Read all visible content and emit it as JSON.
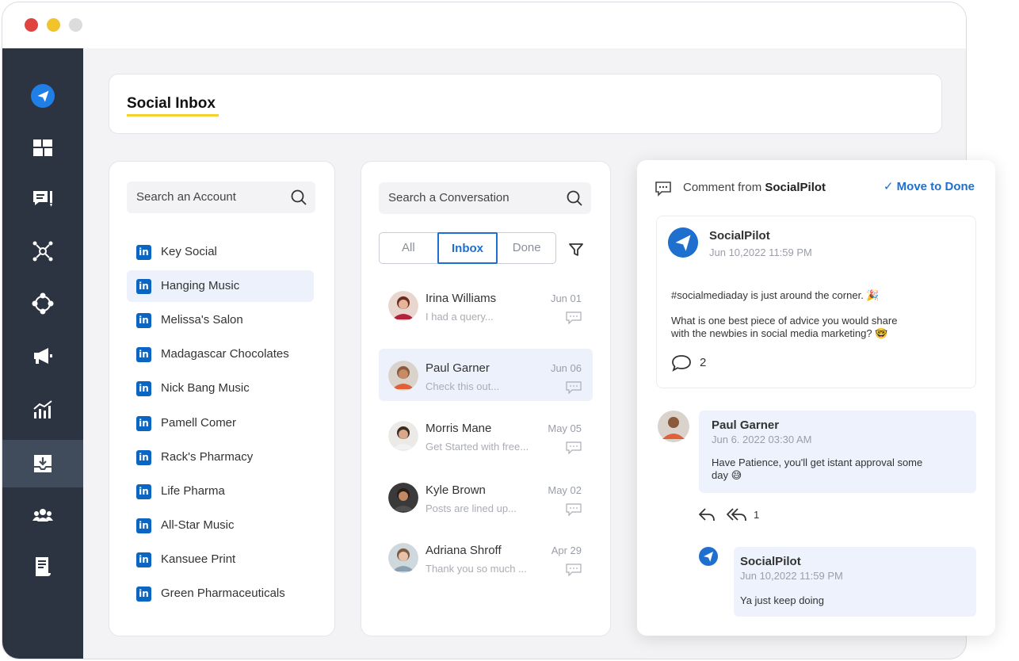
{
  "window": {
    "traffic_lights": [
      "close",
      "minimize",
      "maximize"
    ]
  },
  "sidebar": {
    "items": [
      {
        "icon": "socialpilot-logo-icon"
      },
      {
        "icon": "dashboard-icon"
      },
      {
        "icon": "posts-icon"
      },
      {
        "icon": "network-icon"
      },
      {
        "icon": "integrations-icon"
      },
      {
        "icon": "megaphone-icon"
      },
      {
        "icon": "analytics-icon"
      },
      {
        "icon": "inbox-icon",
        "active": true
      },
      {
        "icon": "team-icon"
      },
      {
        "icon": "reports-icon"
      }
    ]
  },
  "header": {
    "title": "Social Inbox"
  },
  "accounts": {
    "search_placeholder": "Search an Account",
    "items": [
      {
        "name": "Key Social"
      },
      {
        "name": "Hanging Music",
        "active": true
      },
      {
        "name": "Melissa's Salon"
      },
      {
        "name": "Madagascar Chocolates"
      },
      {
        "name": "Nick Bang Music"
      },
      {
        "name": "Pamell Comer"
      },
      {
        "name": "Rack's Pharmacy"
      },
      {
        "name": "Life Pharma"
      },
      {
        "name": "All-Star Music"
      },
      {
        "name": "Kansuee Print"
      },
      {
        "name": "Green Pharmaceuticals"
      }
    ],
    "network_icon_text": "in"
  },
  "conversations": {
    "search_placeholder": "Search a Conversation",
    "tabs": [
      "All",
      "Inbox",
      "Done"
    ],
    "active_tab": "Inbox",
    "items": [
      {
        "name": "Irina Williams",
        "preview": "I had a query...",
        "date": "Jun 01"
      },
      {
        "name": "Paul Garner",
        "preview": "Check this out...",
        "date": "Jun 06",
        "active": true
      },
      {
        "name": "Morris Mane",
        "preview": "Get Started with free...",
        "date": "May 05"
      },
      {
        "name": "Kyle Brown",
        "preview": "Posts are lined up...",
        "date": "May 02"
      },
      {
        "name": "Adriana Shroff",
        "preview": "Thank you so much ...",
        "date": "Apr 29"
      }
    ]
  },
  "detail": {
    "header_prefix": "Comment from",
    "header_source": "SocialPilot",
    "move_to_done": "Move to Done",
    "post": {
      "author": "SocialPilot",
      "time": "Jun 10,2022 11:59 PM",
      "line1": "#socialmediaday is just around the corner. 🎉",
      "line2": "What is one best piece of advice you would share",
      "line3": "with the newbies in social media marketing? 🤓",
      "comment_count": "2"
    },
    "comment": {
      "author": "Paul Garner",
      "time": "Jun 6. 2022 03:30 AM",
      "line1": "Have Patience, you'll get istant approval some",
      "line2": "day 😅",
      "reply_count": "1"
    },
    "reply": {
      "author": "SocialPilot",
      "time": "Jun 10,2022 11:59 PM",
      "text": "Ya just keep doing"
    }
  },
  "colors": {
    "sidebar_bg": "#2c3441",
    "sidebar_active": "#404c5c",
    "accent": "#1f6fcf",
    "linkedin": "#0a66c2",
    "title_underline": "#f6d231",
    "bubble_bg": "#edf2fd"
  }
}
